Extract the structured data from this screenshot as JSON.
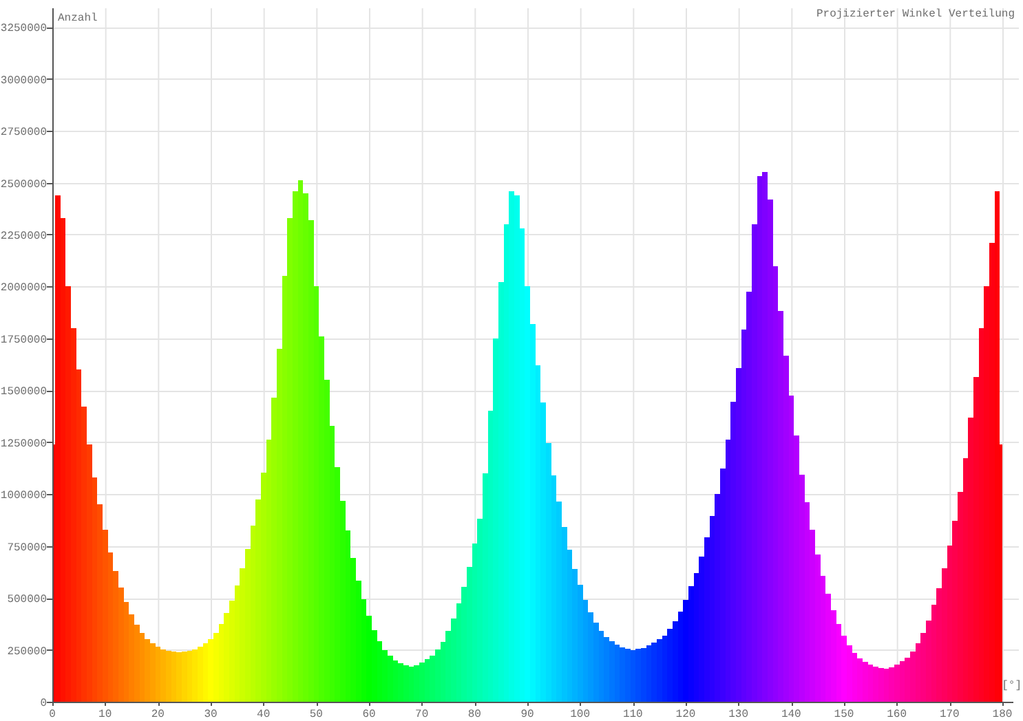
{
  "chart": {
    "chart_data": {
      "type": "bar",
      "title": "Projizierter Winkel Verteilung",
      "xlabel": "[°]",
      "ylabel": "Anzahl",
      "x": [
        0,
        1,
        2,
        3,
        4,
        5,
        6,
        7,
        8,
        9,
        10,
        11,
        12,
        13,
        14,
        15,
        16,
        17,
        18,
        19,
        20,
        21,
        22,
        23,
        24,
        25,
        26,
        27,
        28,
        29,
        30,
        31,
        32,
        33,
        34,
        35,
        36,
        37,
        38,
        39,
        40,
        41,
        42,
        43,
        44,
        45,
        46,
        47,
        48,
        49,
        50,
        51,
        52,
        53,
        54,
        55,
        56,
        57,
        58,
        59,
        60,
        61,
        62,
        63,
        64,
        65,
        66,
        67,
        68,
        69,
        70,
        71,
        72,
        73,
        74,
        75,
        76,
        77,
        78,
        79,
        80,
        81,
        82,
        83,
        84,
        85,
        86,
        87,
        88,
        89,
        90,
        91,
        92,
        93,
        94,
        95,
        96,
        97,
        98,
        99,
        100,
        101,
        102,
        103,
        104,
        105,
        106,
        107,
        108,
        109,
        110,
        111,
        112,
        113,
        114,
        115,
        116,
        117,
        118,
        119,
        120,
        121,
        122,
        123,
        124,
        125,
        126,
        127,
        128,
        129,
        130,
        131,
        132,
        133,
        134,
        135,
        136,
        137,
        138,
        139,
        140,
        141,
        142,
        143,
        144,
        145,
        146,
        147,
        148,
        149,
        150,
        151,
        152,
        153,
        154,
        155,
        156,
        157,
        158,
        159,
        160,
        161,
        162,
        163,
        164,
        165,
        166,
        167,
        168,
        169,
        170,
        171,
        172,
        173,
        174,
        175,
        176,
        177,
        178,
        179,
        180
      ],
      "series": [
        {
          "values": [
            1240000,
            2440000,
            2330000,
            2000000,
            1800000,
            1600000,
            1420000,
            1240000,
            1080000,
            950000,
            830000,
            720000,
            630000,
            550000,
            480000,
            420000,
            370000,
            330000,
            300000,
            280000,
            265000,
            252000,
            245000,
            241000,
            240000,
            241000,
            245000,
            251000,
            265000,
            281000,
            301000,
            333000,
            374000,
            426000,
            487000,
            560000,
            642000,
            735000,
            848000,
            973000,
            1103000,
            1262000,
            1466000,
            1700000,
            2050000,
            2330000,
            2460000,
            2510000,
            2450000,
            2320000,
            2000000,
            1761000,
            1551000,
            1328000,
            1129000,
            966000,
            825000,
            692000,
            584000,
            493000,
            413000,
            346000,
            292000,
            250000,
            221000,
            200000,
            184000,
            175000,
            170000,
            177000,
            188000,
            204000,
            223000,
            252000,
            289000,
            342000,
            401000,
            475000,
            555000,
            651000,
            761000,
            880000,
            1100000,
            1400000,
            1750000,
            2020000,
            2300000,
            2460000,
            2440000,
            2280000,
            2000000,
            1819000,
            1620000,
            1443000,
            1245000,
            1090000,
            964000,
            842000,
            732000,
            641000,
            562000,
            491000,
            431000,
            380000,
            341000,
            310000,
            290000,
            274000,
            261000,
            254000,
            250000,
            255000,
            259000,
            271000,
            285000,
            301000,
            319000,
            351000,
            388000,
            434000,
            489000,
            558000,
            620000,
            699000,
            791000,
            894000,
            1002000,
            1124000,
            1262000,
            1446000,
            1607000,
            1791000,
            1975000,
            2300000,
            2530000,
            2550000,
            2420000,
            2096000,
            1881000,
            1666000,
            1475000,
            1283000,
            1092000,
            961000,
            829000,
            710000,
            607000,
            519000,
            442000,
            375000,
            318000,
            272000,
            236000,
            210000,
            193000,
            179000,
            170000,
            162000,
            160000,
            167000,
            178000,
            195000,
            213000,
            243000,
            280000,
            333000,
            392000,
            466000,
            546000,
            643000,
            753000,
            873000,
            1011000,
            1172000,
            1368000,
            1563000,
            1800000,
            2000000,
            2210000,
            2460000,
            1240000
          ]
        }
      ],
      "grid": true,
      "xlim": [
        0,
        180
      ],
      "ylim": [
        0,
        3340000
      ],
      "xticks": [
        0,
        10,
        20,
        30,
        40,
        50,
        60,
        70,
        80,
        90,
        100,
        110,
        120,
        130,
        140,
        150,
        160,
        170,
        180
      ],
      "yticks": [
        0,
        250000,
        500000,
        750000,
        1000000,
        1250000,
        1500000,
        1750000,
        2000000,
        2250000,
        2500000,
        2750000,
        3000000,
        3250000
      ]
    }
  }
}
